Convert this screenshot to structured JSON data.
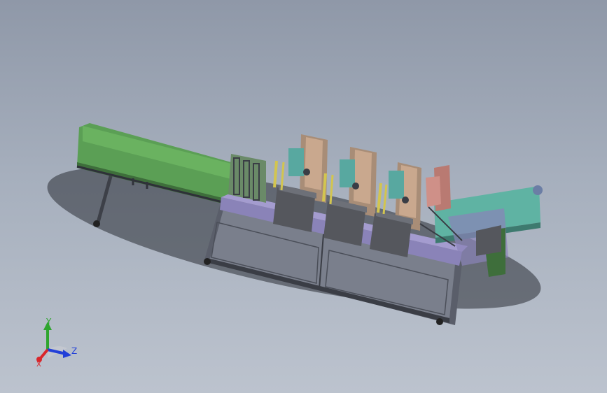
{
  "model": {
    "description_icon": "machine-assembly-icon"
  },
  "triad": {
    "axis_y": "Y",
    "axis_z": "Z",
    "axis_x": "X",
    "color_x": "#d9262b",
    "color_y": "#2ea52e",
    "color_z": "#2240d8"
  },
  "colors": {
    "background_top": "#8f98a8",
    "background_bottom": "#bcc3ce",
    "frame": "#6a6f7c",
    "conveyor_green": "#62a95c",
    "conveyor_teal": "#5fb3a3",
    "plate_dark": "#55575d",
    "panel_brown": "#c3a38a",
    "base_purple": "#8a83b8"
  }
}
